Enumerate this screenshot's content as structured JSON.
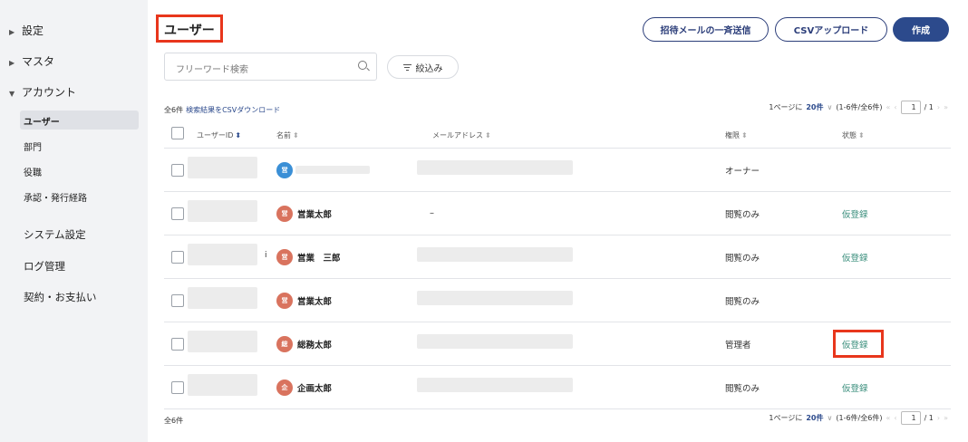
{
  "sidebar": {
    "settings": "設定",
    "master": "マスタ",
    "account": "アカウント",
    "account_items": [
      "ユーザー",
      "部門",
      "役職",
      "承認・発行経路"
    ],
    "system_settings": "システム設定",
    "log_management": "ログ管理",
    "contract_payment": "契約・お支払い"
  },
  "header": {
    "title": "ユーザー",
    "invite_button": "招待メールの一斉送信",
    "csv_upload_button": "CSVアップロード",
    "create_button": "作成"
  },
  "search": {
    "placeholder": "フリーワード検索",
    "filter_label": "絞込み"
  },
  "list": {
    "count_label": "全6件",
    "csv_download": "検索結果をCSVダウンロード",
    "pager": {
      "prefix": "1ページに",
      "per_page": "20件",
      "range": "(1-6件/全6件)",
      "page": "1",
      "total_pages": "/ 1"
    },
    "columns": {
      "user_id": "ユーザーID",
      "name": "名前",
      "email": "メールアドレス",
      "role": "権限",
      "status": "状態"
    },
    "rows": [
      {
        "avatar": "営",
        "avatar_color": "#3a8fd6",
        "name": "",
        "email": "",
        "role": "オーナー",
        "status": ""
      },
      {
        "avatar": "営",
        "avatar_color": "#d9735e",
        "name": "営業太郎",
        "email": "–",
        "role": "閲覧のみ",
        "status": "仮登録"
      },
      {
        "avatar": "営",
        "avatar_color": "#d9735e",
        "name": "営業　三郎",
        "email": "",
        "role": "閲覧のみ",
        "status": "仮登録",
        "user_id_fragment": "i"
      },
      {
        "avatar": "営",
        "avatar_color": "#d9735e",
        "name": "営業太郎",
        "email": "",
        "role": "閲覧のみ",
        "status": ""
      },
      {
        "avatar": "総",
        "avatar_color": "#d9735e",
        "name": "総務太郎",
        "email": "",
        "role": "管理者",
        "status": "仮登録"
      },
      {
        "avatar": "企",
        "avatar_color": "#d9735e",
        "name": "企画太郎",
        "email": "",
        "role": "閲覧のみ",
        "status": "仮登録"
      }
    ],
    "footer_count": "全6件"
  },
  "colors": {
    "accent": "#2c4a8c",
    "highlight": "#e8361c",
    "status": "#3a8e7c"
  }
}
